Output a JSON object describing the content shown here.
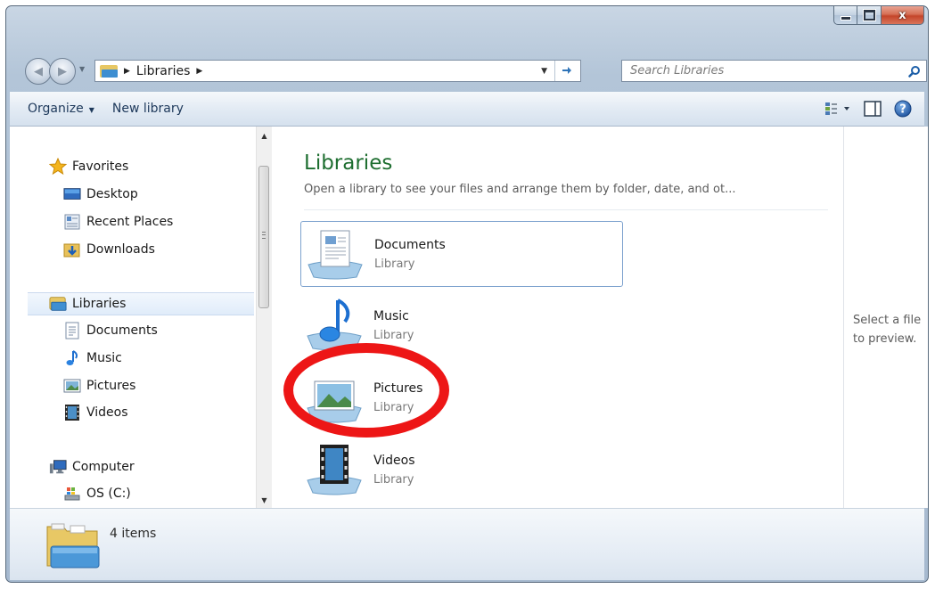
{
  "window": {
    "caption": {
      "minimize_glyph": "minimize-glyph",
      "maximize_glyph": "maximize-glyph",
      "close_glyph": "x"
    }
  },
  "address": {
    "breadcrumb": "Libraries"
  },
  "search": {
    "placeholder": "Search Libraries"
  },
  "toolbar": {
    "organize_label": "Organize",
    "new_library_label": "New library"
  },
  "navpane": {
    "favorites": {
      "label": "Favorites",
      "items": [
        {
          "label": "Desktop"
        },
        {
          "label": "Recent Places"
        },
        {
          "label": "Downloads"
        }
      ]
    },
    "libraries": {
      "label": "Libraries",
      "items": [
        {
          "label": "Documents"
        },
        {
          "label": "Music"
        },
        {
          "label": "Pictures"
        },
        {
          "label": "Videos"
        }
      ]
    },
    "computer": {
      "label": "Computer",
      "items": [
        {
          "label": "OS (C:)"
        }
      ]
    }
  },
  "main": {
    "title": "Libraries",
    "subtitle": "Open a library to see your files and arrange them by folder, date, and ot...",
    "libraries": [
      {
        "name": "Documents",
        "type": "Library"
      },
      {
        "name": "Music",
        "type": "Library"
      },
      {
        "name": "Pictures",
        "type": "Library"
      },
      {
        "name": "Videos",
        "type": "Library"
      }
    ]
  },
  "preview": {
    "text": "Select a file to preview."
  },
  "status": {
    "count": "4 items"
  },
  "colors": {
    "annotation": "#ed1616",
    "title_green": "#1e6e30",
    "toolbar_text": "#1e395b",
    "selection_border": "#7da2ce"
  }
}
